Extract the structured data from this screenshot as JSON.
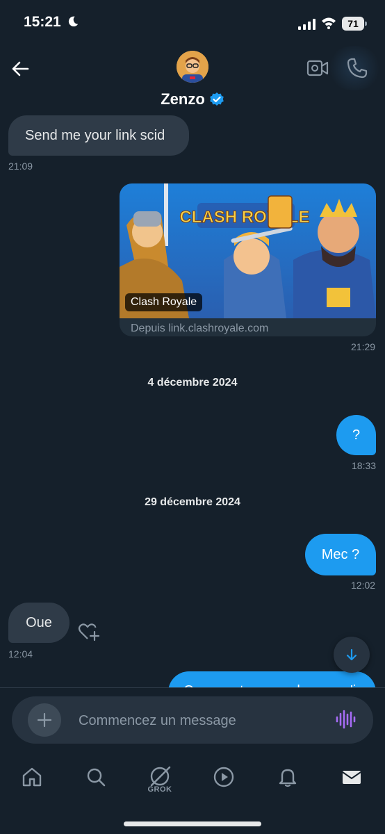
{
  "status_bar": {
    "time": "15:21",
    "battery": "71"
  },
  "header": {
    "contact_name": "Zenzo",
    "verified": true,
    "back_icon": "arrow-left-icon",
    "video_icon": "video-camera-icon",
    "call_icon": "phone-icon"
  },
  "messages": {
    "m1": {
      "text": "Send me your link scid",
      "time": "21:09",
      "direction": "incoming"
    },
    "link_card": {
      "title": "Clash Royale",
      "source": "Depuis link.clashroyale.com",
      "banner_text": "CLASH ROYALE",
      "time": "21:29",
      "direction": "outgoing"
    },
    "date1": "4 décembre 2024",
    "m2": {
      "text": "?",
      "time": "18:33",
      "direction": "outgoing"
    },
    "date2": "29 décembre 2024",
    "m3": {
      "text": "Mec ?",
      "time": "12:02",
      "direction": "outgoing"
    },
    "m4": {
      "text": "Oue",
      "time": "12:04",
      "direction": "incoming"
    },
    "m5_partial": {
      "text": "Comment ça marche ce qu'i…",
      "direction": "outgoing"
    }
  },
  "composer": {
    "placeholder": "Commencez un message",
    "plus_icon": "plus-icon",
    "voice_icon": "voice-wave-icon"
  },
  "tabbar": {
    "grok_label": "GROK",
    "items": [
      "home-icon",
      "search-icon",
      "grok-icon",
      "play-icon",
      "bell-icon",
      "mail-icon"
    ]
  },
  "colors": {
    "background": "#15202b",
    "accent": "#1d9bf0",
    "incoming_bubble": "#2f3b48",
    "muted_text": "#8b98a5"
  }
}
